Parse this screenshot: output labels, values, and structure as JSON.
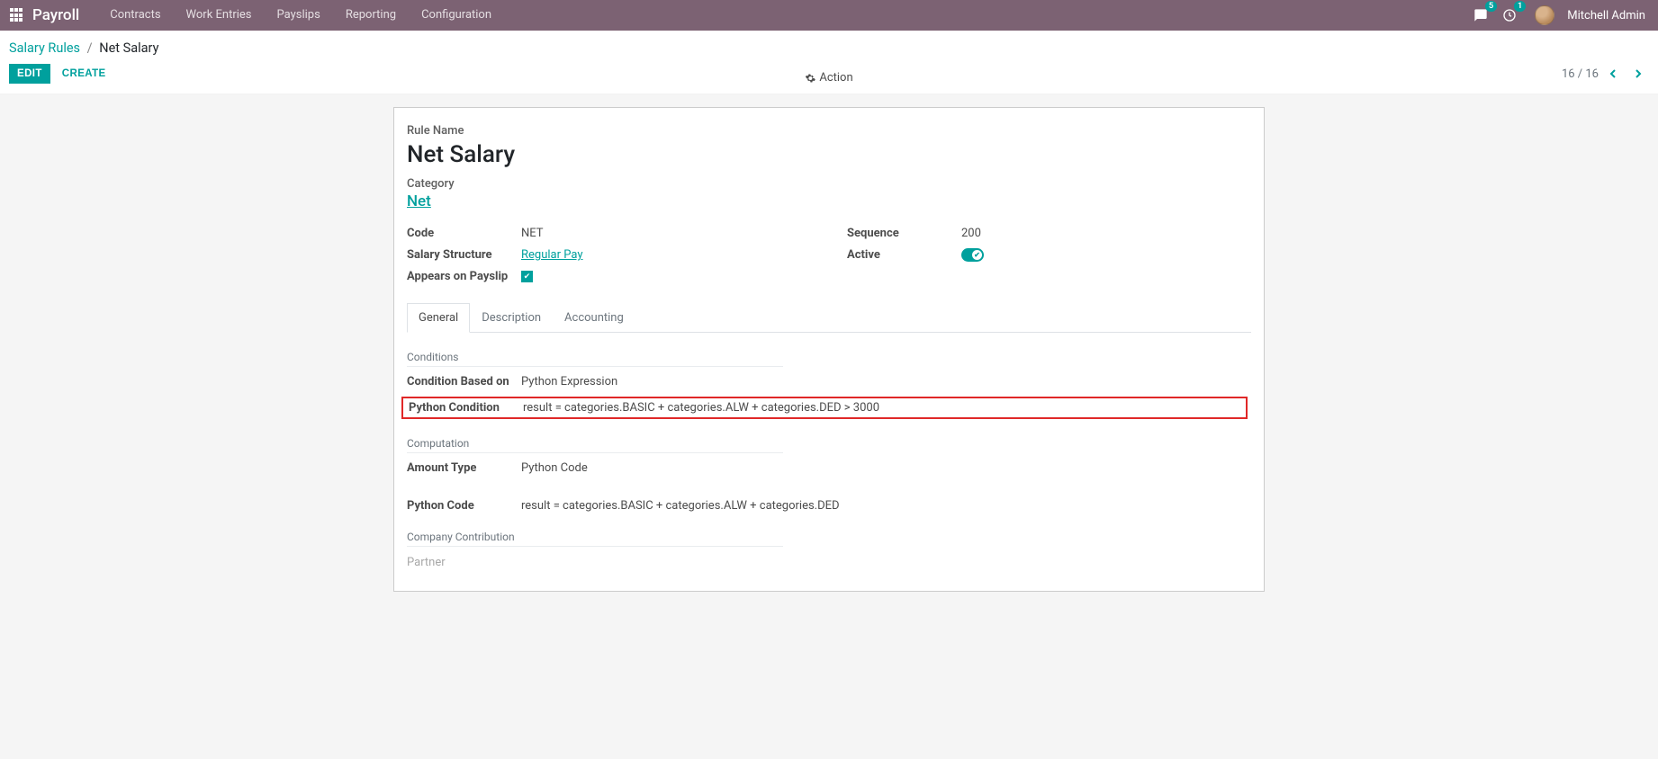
{
  "nav": {
    "brand": "Payroll",
    "menu": [
      "Contracts",
      "Work Entries",
      "Payslips",
      "Reporting",
      "Configuration"
    ],
    "msg_badge": "5",
    "clock_badge": "1",
    "username": "Mitchell Admin"
  },
  "breadcrumb": {
    "parent": "Salary Rules",
    "sep": "/",
    "current": "Net Salary"
  },
  "controls": {
    "edit": "EDIT",
    "create": "CREATE",
    "action": "Action",
    "pager": "16 / 16"
  },
  "form": {
    "rule_name_label": "Rule Name",
    "rule_name": "Net Salary",
    "category_label": "Category",
    "category": "Net",
    "left": {
      "code_label": "Code",
      "code": "NET",
      "struct_label": "Salary Structure",
      "struct": "Regular Pay",
      "appears_label": "Appears on Payslip"
    },
    "right": {
      "seq_label": "Sequence",
      "seq": "200",
      "active_label": "Active"
    },
    "tabs": {
      "general": "General",
      "description": "Description",
      "accounting": "Accounting"
    },
    "sections": {
      "conditions_h": "Conditions",
      "cond_based_label": "Condition Based on",
      "cond_based": "Python Expression",
      "pycond_label": "Python Condition",
      "pycond": "result = categories.BASIC + categories.ALW + categories.DED > 3000",
      "computation_h": "Computation",
      "amount_type_label": "Amount Type",
      "amount_type": "Python Code",
      "pycode_label": "Python Code",
      "pycode": "result = categories.BASIC + categories.ALW + categories.DED",
      "cc_h": "Company Contribution",
      "partner_label": "Partner"
    }
  }
}
